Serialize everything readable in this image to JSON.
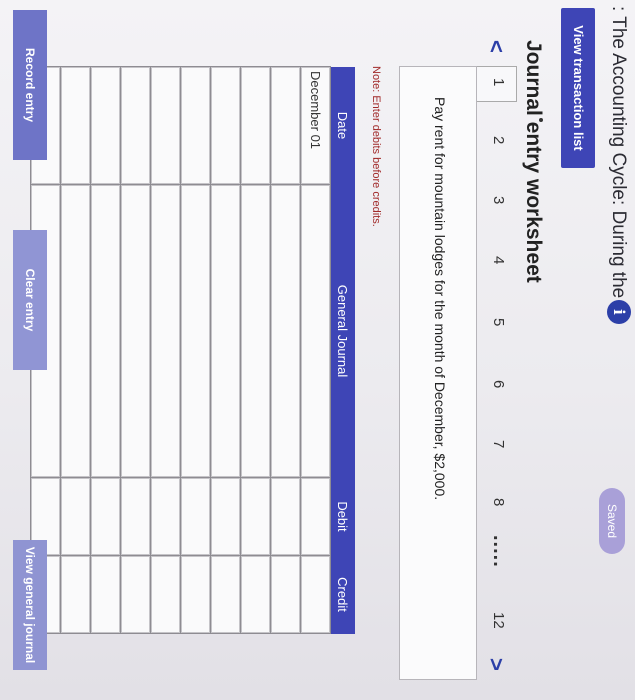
{
  "header": {
    "title": ": The Accounting Cycle: During the ...",
    "info_icon": "i",
    "status": "Saved"
  },
  "view_transaction_list_label": "View transaction list",
  "worksheet": {
    "title": "Journal entry worksheet",
    "nav": {
      "prev": "<",
      "next": ">",
      "pages": [
        "1",
        "2",
        "3",
        "4",
        "5",
        "6",
        "7",
        "8"
      ],
      "ellipsis": ".....",
      "last": "12",
      "selected": "1"
    },
    "description": "Pay rent for mountain lodges for the month of December, $2,000.",
    "note": "Note: Enter debits before credits."
  },
  "journal": {
    "columns": [
      "Date",
      "General Journal",
      "Debit",
      "Credit"
    ],
    "rows": [
      [
        "December 01",
        "",
        "",
        ""
      ],
      [
        "",
        "",
        "",
        ""
      ],
      [
        "",
        "",
        "",
        ""
      ],
      [
        "",
        "",
        "",
        ""
      ],
      [
        "",
        "",
        "",
        ""
      ],
      [
        "",
        "",
        "",
        ""
      ],
      [
        "",
        "",
        "",
        ""
      ],
      [
        "",
        "",
        "",
        ""
      ],
      [
        "",
        "",
        "",
        ""
      ],
      [
        "",
        "",
        "",
        ""
      ]
    ]
  },
  "buttons": {
    "record": "Record entry",
    "clear": "Clear entry",
    "view_general_journal": "View general journal"
  }
}
